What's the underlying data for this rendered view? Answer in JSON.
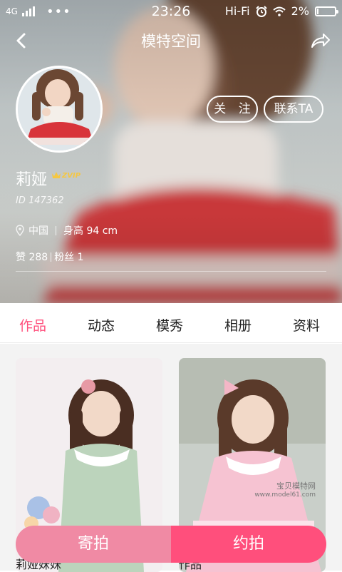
{
  "status_bar": {
    "network": "4G",
    "time": "23:26",
    "carrier": "Hi-Fi",
    "battery": "2%"
  },
  "nav": {
    "title": "模特空间"
  },
  "profile": {
    "name": "莉娅",
    "vip": "ZVIP",
    "id": "ID 147362",
    "location": "中国",
    "height": "身高 94 cm",
    "likes": "赞 288",
    "fans": "粉丝 1"
  },
  "actions": {
    "follow": "关 注",
    "contact": "联系TA"
  },
  "tabs": [
    {
      "label": "作品",
      "active": true
    },
    {
      "label": "动态",
      "active": false
    },
    {
      "label": "模秀",
      "active": false
    },
    {
      "label": "相册",
      "active": false
    },
    {
      "label": "资料",
      "active": false
    }
  ],
  "cards": [
    {
      "caption": "莉娅妹妹"
    },
    {
      "caption": "作品",
      "watermark_line1": "宝贝模特网",
      "watermark_line2": "www.model61.com"
    }
  ],
  "bottom_bar": {
    "left_label": "寄拍",
    "right_label": "约拍"
  },
  "colors": {
    "accent": "#ff4f7c",
    "accent_light": "#f08aa4",
    "vip_gold": "#f5c742"
  }
}
